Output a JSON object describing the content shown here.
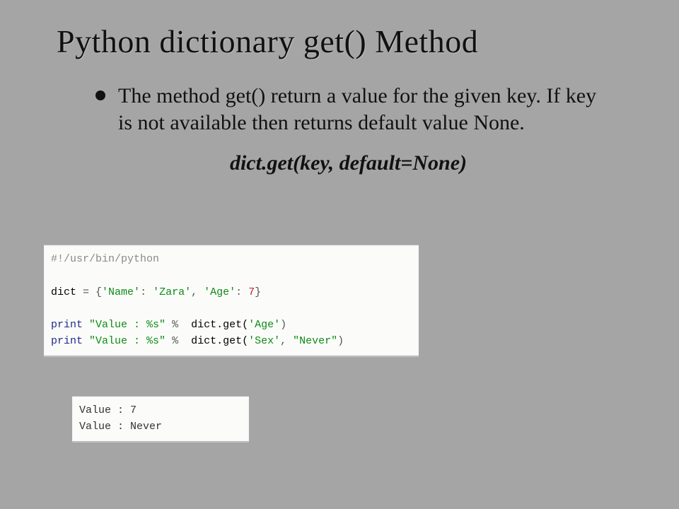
{
  "title": "Python dictionary get() Method",
  "bullet_text": "The method get() return a value for the given key. If key is not available then returns default value None.",
  "signature": "dict.get(key, default=None)",
  "code": {
    "l1_comment": "#!/usr/bin/python",
    "l3_a": "dict ",
    "l3_b": "=",
    "l3_c": " {",
    "l3_d": "'Name'",
    "l3_e": ": ",
    "l3_f": "'Zara'",
    "l3_g": ", ",
    "l3_h": "'Age'",
    "l3_i": ": ",
    "l3_j": "7",
    "l3_k": "}",
    "l5_a": "print",
    "l5_b": " ",
    "l5_c": "\"Value : %s\"",
    "l5_d": " % ",
    "l5_e": " dict.get(",
    "l5_f": "'Age'",
    "l5_g": ")",
    "l6_a": "print",
    "l6_b": " ",
    "l6_c": "\"Value : %s\"",
    "l6_d": " % ",
    "l6_e": " dict.get(",
    "l6_f": "'Sex'",
    "l6_g": ", ",
    "l6_h": "\"Never\"",
    "l6_i": ")"
  },
  "output": {
    "line1": "Value : 7",
    "line2": "Value : Never"
  }
}
